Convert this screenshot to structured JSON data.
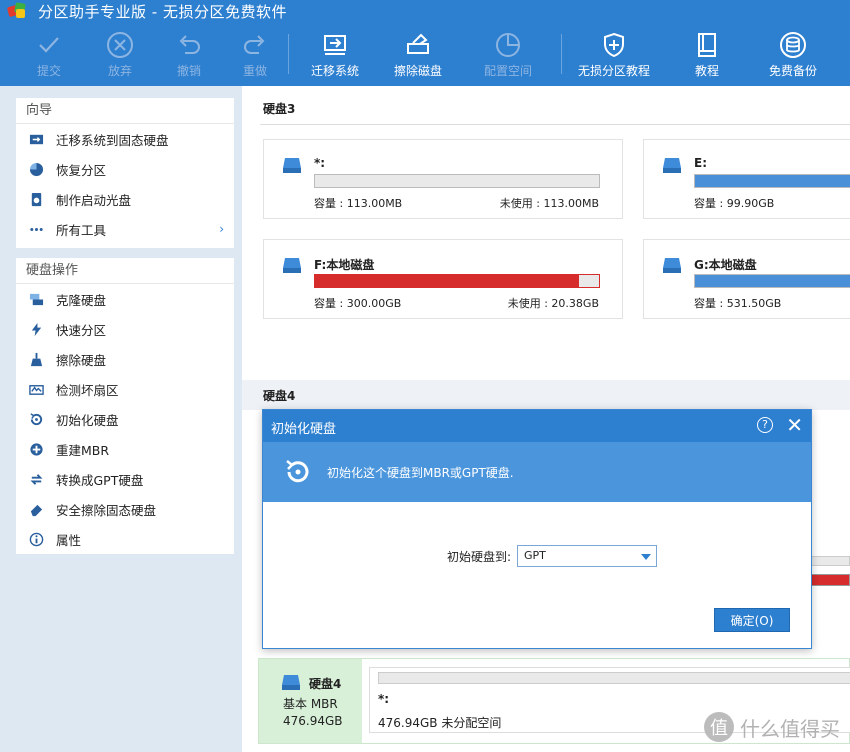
{
  "window": {
    "title": "分区助手专业版 - 无损分区免费软件"
  },
  "toolbar": {
    "commit": "提交",
    "discard": "放弃",
    "undo": "撤销",
    "redo": "重做",
    "migrate_os": "迁移系统",
    "wipe_disk": "擦除磁盘",
    "allocate_space": "配置空间",
    "tutorial_lossless": "无损分区教程",
    "tutorial": "教程",
    "free_backup": "免费备份"
  },
  "sidebar": {
    "wizard_title": "向导",
    "wizard_items": [
      {
        "label": "迁移系统到固态硬盘",
        "icon": "migrate-ssd-icon"
      },
      {
        "label": "恢复分区",
        "icon": "recover-partition-icon"
      },
      {
        "label": "制作启动光盘",
        "icon": "bootable-disc-icon"
      },
      {
        "label": "所有工具",
        "icon": "all-tools-icon"
      }
    ],
    "disk_ops_title": "硬盘操作",
    "disk_ops_items": [
      {
        "label": "克隆硬盘",
        "icon": "clone-disk-icon"
      },
      {
        "label": "快速分区",
        "icon": "quick-partition-icon"
      },
      {
        "label": "擦除硬盘",
        "icon": "wipe-disk-icon"
      },
      {
        "label": "检测坏扇区",
        "icon": "bad-sector-icon"
      },
      {
        "label": "初始化硬盘",
        "icon": "initialize-disk-icon"
      },
      {
        "label": "重建MBR",
        "icon": "rebuild-mbr-icon"
      },
      {
        "label": "转换成GPT硬盘",
        "icon": "convert-gpt-icon"
      },
      {
        "label": "安全擦除固态硬盘",
        "icon": "secure-erase-icon"
      },
      {
        "label": "属性",
        "icon": "info-icon"
      }
    ]
  },
  "main": {
    "disk3": {
      "title": "硬盘3",
      "partitions": [
        {
          "name": "*:",
          "capacity": "容量 : 113.00MB",
          "free": "未使用 : 113.00MB",
          "used_fraction": 0.0,
          "color": "#e9e9e9"
        },
        {
          "name": "E:",
          "capacity": "容量 : 99.90GB",
          "free": "",
          "used_fraction": 1.0,
          "color": "#4a90d9"
        },
        {
          "name": "F:本地磁盘",
          "capacity": "容量 : 300.00GB",
          "free": "未使用 : 20.38GB",
          "used_fraction": 0.93,
          "color": "#d62c2c"
        },
        {
          "name": "G:本地磁盘",
          "capacity": "容量 : 531.50GB",
          "free": "",
          "used_fraction": 1.0,
          "color": "#4a90d9"
        }
      ]
    },
    "disk4": {
      "title": "硬盘4",
      "type": "基本 MBR",
      "size": "476.94GB",
      "partition_name": "*:",
      "partition_size": "476.94GB 未分配空间"
    }
  },
  "dialog": {
    "title": "初始化硬盘",
    "message": "初始化这个硬盘到MBR或GPT硬盘.",
    "label": "初始硬盘到:",
    "select_value": "GPT",
    "ok": "确定(O)"
  },
  "watermark": {
    "logo": "值",
    "text": "什么值得买"
  }
}
